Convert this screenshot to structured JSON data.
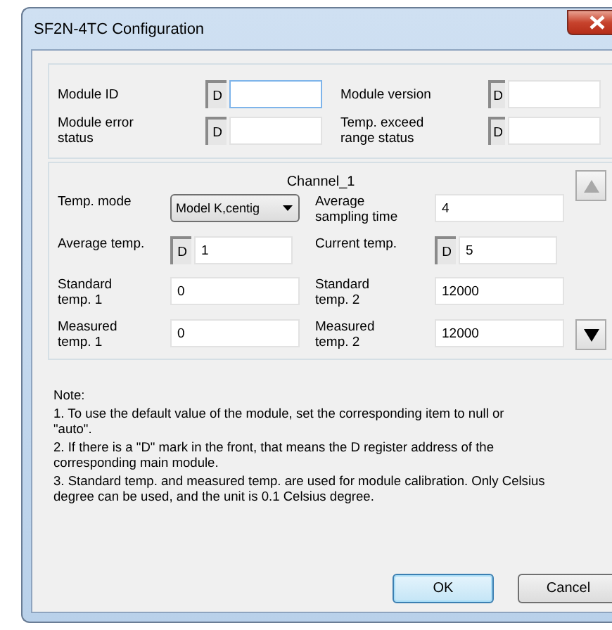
{
  "window": {
    "title": "SF2N-4TC Configuration"
  },
  "module_fields": [
    {
      "label": "Module ID",
      "kind": "d_field",
      "prefix": "D",
      "focused": true
    },
    {
      "label": "Module version",
      "kind": "d_field",
      "prefix": "D",
      "focused": false
    },
    {
      "label": "Module error status",
      "kind": "d_field",
      "prefix": "D",
      "focused": false
    },
    {
      "label": "Temp. exceed range status",
      "kind": "d_field",
      "prefix": "D",
      "focused": false
    }
  ],
  "channel": {
    "title": "Channel_1",
    "fields": [
      {
        "label": "Temp. mode",
        "kind": "combo",
        "value": "Model K,centig"
      },
      {
        "label": "Average sampling time",
        "kind": "text",
        "value": "4"
      },
      {
        "label": "Average temp.",
        "kind": "d_field",
        "prefix": "D",
        "value": "1"
      },
      {
        "label": "Current temp.",
        "kind": "d_field",
        "prefix": "D",
        "value": "5"
      },
      {
        "label": "Standard temp. 1",
        "kind": "text",
        "value": "0"
      },
      {
        "label": "Standard temp. 2",
        "kind": "text",
        "value": "12000"
      },
      {
        "label": "Measured temp. 1",
        "kind": "text",
        "value": "0"
      },
      {
        "label": "Measured temp. 2",
        "kind": "text",
        "value": "12000"
      }
    ],
    "scroll_buttons": [
      {
        "kind": "up",
        "disabled": true
      },
      {
        "kind": "down",
        "disabled": false
      }
    ]
  },
  "note": {
    "title": "Note:",
    "items": [
      "1. To use the default value of the module, set the corresponding item to null or \"auto\".",
      "2. If there is a \"D\" mark in the front, that means the D register address of the corresponding main module.",
      "3. Standard temp. and measured temp. are used for module calibration. Only Celsius degree can be used, and the unit is 0.1 Celsius degree."
    ]
  },
  "buttons": [
    {
      "label": "OK",
      "default": true
    },
    {
      "label": "Cancel",
      "default": false
    }
  ]
}
